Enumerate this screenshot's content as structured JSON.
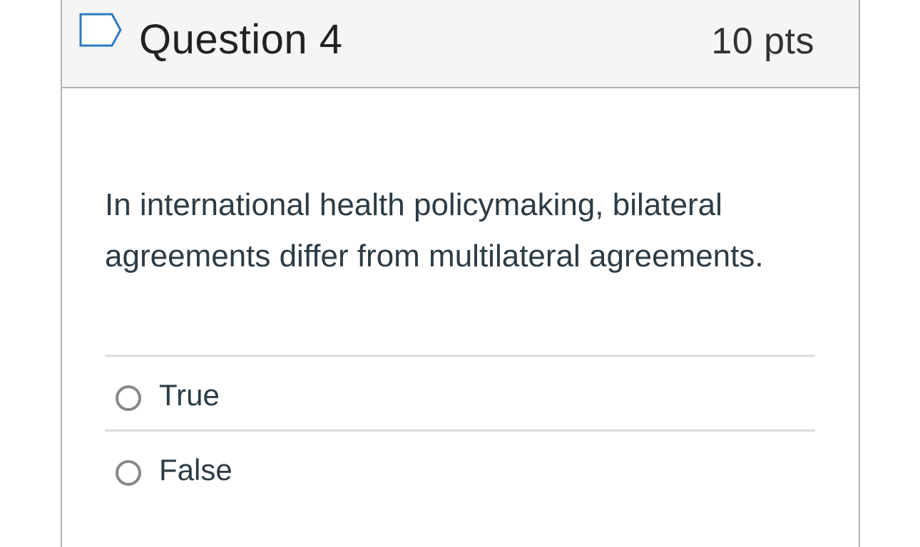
{
  "question": {
    "title": "Question 4",
    "points": "10 pts",
    "text": "In international health policymaking, bilateral agreements differ from multilateral agreements.",
    "flag_icon": "bookmark-flag-icon"
  },
  "answers": [
    {
      "label": "True",
      "selected": false
    },
    {
      "label": "False",
      "selected": false
    }
  ],
  "colors": {
    "header_bg": "#f5f5f5",
    "border": "#b0b3b5",
    "flag_stroke": "#2b7abc",
    "radio_stroke": "#888888",
    "text": "#2d3b45"
  }
}
